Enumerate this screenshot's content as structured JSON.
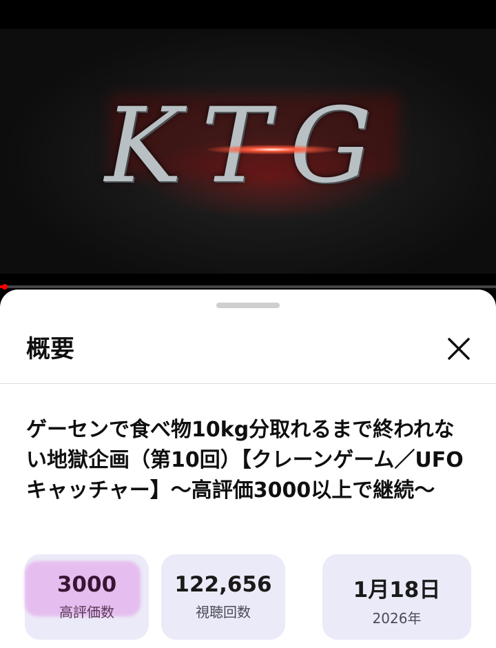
{
  "video": {
    "logo_text": "KTG",
    "progress_fraction": 0.01
  },
  "description_panel": {
    "title": "概要",
    "close_icon": "close-icon",
    "video_title": "ゲーセンで食べ物10kg分取れるまで終われない地獄企画（第10回）【クレーンゲーム／UFOキャッチャー】〜高評価3000以上で継続〜",
    "stats": [
      {
        "value": "3000",
        "label": "高評価数"
      },
      {
        "value": "122,656",
        "label": "視聴回数"
      },
      {
        "value": "1月18日",
        "label": "2026年"
      }
    ]
  },
  "colors": {
    "progress": "#ff0000",
    "stat_bg": "#ebeaf8",
    "highlight": "#e6bdef"
  }
}
